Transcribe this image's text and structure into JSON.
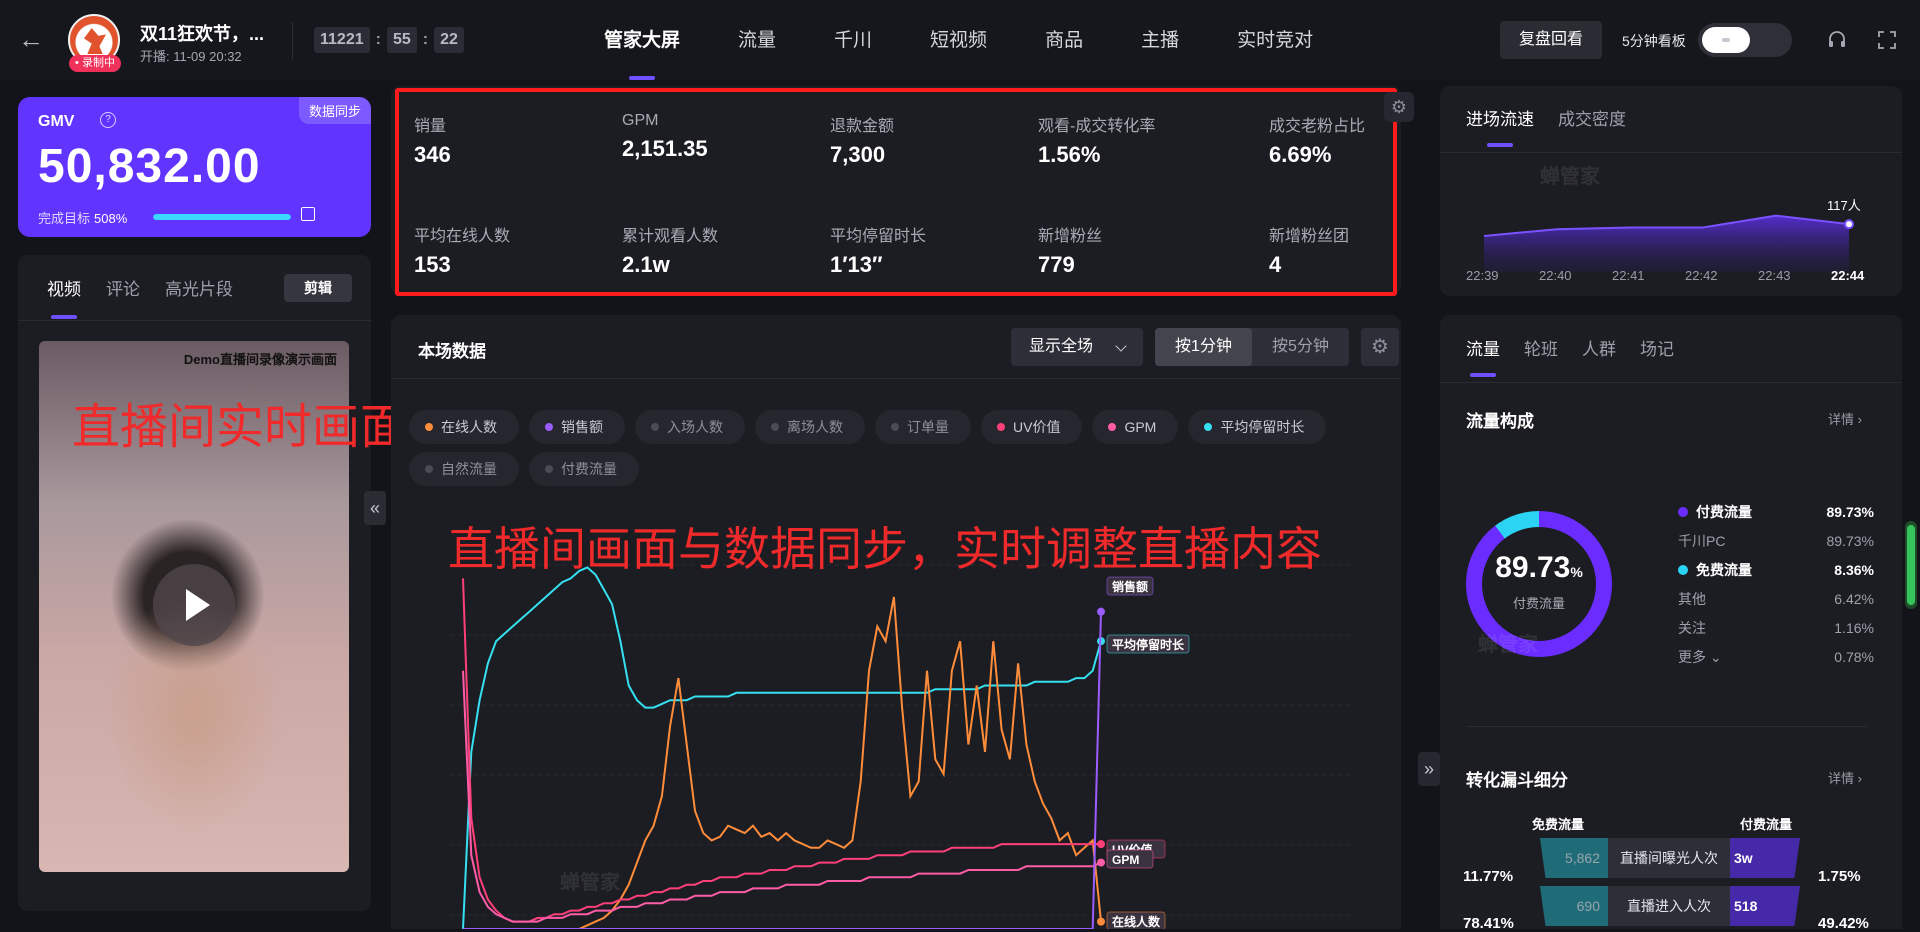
{
  "topbar": {
    "back_icon": "arrow-left-icon",
    "room_title": "双11狂欢节，...",
    "recording_badge": "• 录制中",
    "start_time": "开播:  11-09 20:32",
    "timer": {
      "hours": "11221",
      "minutes": "55",
      "seconds": "22"
    },
    "nav_tabs": [
      {
        "label": "管家大屏",
        "active": true
      },
      {
        "label": "流量"
      },
      {
        "label": "千川"
      },
      {
        "label": "短视频"
      },
      {
        "label": "商品"
      },
      {
        "label": "主播"
      },
      {
        "label": "实时竞对"
      }
    ],
    "replay_button": "复盘回看",
    "five_min_board": "5分钟看板",
    "headset_icon": "headset-icon",
    "fullscreen_icon": "fullscreen-icon"
  },
  "gmv": {
    "label": "GMV",
    "sync_badge": "数据同步",
    "value": "50,832.00",
    "target_label": "完成目标",
    "target_pct": "508%",
    "progress": 1.0
  },
  "video_panel": {
    "tabs": [
      "视频",
      "评论",
      "高光片段"
    ],
    "cut_button": "剪辑",
    "demo_caption": "Demo直播间录像演示画面",
    "overlay_text": "直播间实时画面"
  },
  "metrics": [
    {
      "label": "销量",
      "value": "346"
    },
    {
      "label": "GPM",
      "value": "2,151.35"
    },
    {
      "label": "退款金额",
      "value": "7,300"
    },
    {
      "label": "观看-成交转化率",
      "value": "1.56%"
    },
    {
      "label": "成交老粉占比",
      "value": "6.69%"
    },
    {
      "label": "平均在线人数",
      "value": "153"
    },
    {
      "label": "累计观看人数",
      "value": "2.1w"
    },
    {
      "label": "平均停留时长",
      "value": "1′13′′"
    },
    {
      "label": "新增粉丝",
      "value": "779"
    },
    {
      "label": "新增粉丝团",
      "value": "4"
    }
  ],
  "session_data": {
    "title": "本场数据",
    "scope_select": "显示全场",
    "granularity": [
      "按1分钟",
      "按5分钟"
    ],
    "legend": [
      {
        "label": "在线人数",
        "color": "#ff8c3a",
        "on": true
      },
      {
        "label": "销售额",
        "color": "#9b5cff",
        "on": true
      },
      {
        "label": "入场人数",
        "color": "#4a4b55",
        "on": false
      },
      {
        "label": "离场人数",
        "color": "#4a4b55",
        "on": false
      },
      {
        "label": "订单量",
        "color": "#4a4b55",
        "on": false
      },
      {
        "label": "UV价值",
        "color": "#ff3f7a",
        "on": true
      },
      {
        "label": "GPM",
        "color": "#ff5ca8",
        "on": true
      },
      {
        "label": "平均停留时长",
        "color": "#35e0f0",
        "on": true
      },
      {
        "label": "自然流量",
        "color": "#4a4b55",
        "on": false
      },
      {
        "label": "付费流量",
        "color": "#4a4b55",
        "on": false
      }
    ],
    "overlay_text": "直播间画面与数据同步，实时调整直播内容",
    "end_labels": [
      "销售额",
      "平均停留时长",
      "UV价值",
      "GPM",
      "在线人数"
    ]
  },
  "chart_data": {
    "type": "line",
    "title": "",
    "series": [
      {
        "name": "平均停留时长",
        "color": "#35e0f0",
        "values": [
          0,
          0.48,
          0.62,
          0.72,
          0.78,
          0.8,
          0.82,
          0.84,
          0.86,
          0.88,
          0.9,
          0.92,
          0.94,
          0.95,
          0.97,
          0.98,
          0.96,
          0.92,
          0.88,
          0.78,
          0.66,
          0.62,
          0.6,
          0.6,
          0.61,
          0.62,
          0.62,
          0.62,
          0.63,
          0.63,
          0.63,
          0.63,
          0.63,
          0.64,
          0.64,
          0.64,
          0.64,
          0.64,
          0.64,
          0.64,
          0.64,
          0.64,
          0.64,
          0.64,
          0.64,
          0.64,
          0.64,
          0.64,
          0.64,
          0.64,
          0.64,
          0.64,
          0.64,
          0.64,
          0.64,
          0.64,
          0.64,
          0.65,
          0.65,
          0.65,
          0.65,
          0.65,
          0.65,
          0.66,
          0.66,
          0.66,
          0.66,
          0.66,
          0.66,
          0.67,
          0.67,
          0.67,
          0.67,
          0.67,
          0.68,
          0.68,
          0.7,
          0.78
        ]
      },
      {
        "name": "在线人数",
        "color": "#ff8c3a",
        "values": [
          0,
          0,
          0,
          0,
          0,
          0,
          0,
          0,
          0,
          0,
          0,
          0,
          0,
          0,
          0,
          0.01,
          0.02,
          0.03,
          0.05,
          0.08,
          0.12,
          0.18,
          0.24,
          0.28,
          0.36,
          0.55,
          0.68,
          0.5,
          0.32,
          0.26,
          0.24,
          0.25,
          0.28,
          0.27,
          0.26,
          0.28,
          0.25,
          0.26,
          0.24,
          0.26,
          0.24,
          0.23,
          0.22,
          0.22,
          0.24,
          0.23,
          0.22,
          0.24,
          0.4,
          0.7,
          0.82,
          0.78,
          0.9,
          0.6,
          0.36,
          0.4,
          0.7,
          0.46,
          0.42,
          0.7,
          0.78,
          0.5,
          0.66,
          0.48,
          0.78,
          0.54,
          0.46,
          0.72,
          0.5,
          0.4,
          0.34,
          0.3,
          0.24,
          0.26,
          0.2,
          0.22,
          0.24,
          0.02
        ]
      },
      {
        "name": "UV价值",
        "color": "#ff3f7a",
        "values": [
          0.95,
          0.3,
          0.14,
          0.08,
          0.05,
          0.03,
          0.02,
          0.02,
          0.02,
          0.03,
          0.03,
          0.04,
          0.04,
          0.05,
          0.05,
          0.06,
          0.06,
          0.07,
          0.07,
          0.08,
          0.08,
          0.09,
          0.09,
          0.1,
          0.1,
          0.11,
          0.11,
          0.12,
          0.12,
          0.13,
          0.13,
          0.14,
          0.14,
          0.14,
          0.15,
          0.15,
          0.15,
          0.16,
          0.16,
          0.16,
          0.17,
          0.17,
          0.17,
          0.18,
          0.18,
          0.18,
          0.19,
          0.19,
          0.19,
          0.19,
          0.2,
          0.2,
          0.2,
          0.2,
          0.21,
          0.21,
          0.21,
          0.21,
          0.21,
          0.22,
          0.22,
          0.22,
          0.22,
          0.22,
          0.22,
          0.23,
          0.23,
          0.23,
          0.23,
          0.23,
          0.23,
          0.23,
          0.23,
          0.23,
          0.23,
          0.23,
          0.23,
          0.23
        ]
      },
      {
        "name": "GPM",
        "color": "#ff5ca8",
        "values": [
          0.7,
          0.2,
          0.1,
          0.06,
          0.04,
          0.03,
          0.02,
          0.02,
          0.02,
          0.02,
          0.03,
          0.03,
          0.03,
          0.04,
          0.04,
          0.04,
          0.05,
          0.05,
          0.05,
          0.06,
          0.06,
          0.06,
          0.07,
          0.07,
          0.07,
          0.08,
          0.08,
          0.08,
          0.09,
          0.09,
          0.09,
          0.1,
          0.1,
          0.1,
          0.1,
          0.11,
          0.11,
          0.11,
          0.11,
          0.12,
          0.12,
          0.12,
          0.12,
          0.12,
          0.13,
          0.13,
          0.13,
          0.13,
          0.13,
          0.14,
          0.14,
          0.14,
          0.14,
          0.14,
          0.14,
          0.15,
          0.15,
          0.15,
          0.15,
          0.15,
          0.15,
          0.16,
          0.16,
          0.16,
          0.16,
          0.16,
          0.16,
          0.16,
          0.17,
          0.17,
          0.17,
          0.17,
          0.17,
          0.17,
          0.17,
          0.17,
          0.17,
          0.18
        ]
      },
      {
        "name": "销售额",
        "color": "#9b5cff",
        "values": [
          0,
          0,
          0,
          0,
          0,
          0,
          0,
          0,
          0,
          0,
          0,
          0,
          0,
          0,
          0,
          0,
          0,
          0,
          0,
          0,
          0,
          0,
          0,
          0,
          0,
          0,
          0,
          0,
          0,
          0,
          0,
          0,
          0,
          0,
          0,
          0,
          0,
          0,
          0,
          0,
          0,
          0,
          0,
          0,
          0,
          0,
          0,
          0,
          0,
          0,
          0,
          0,
          0,
          0,
          0,
          0,
          0,
          0,
          0,
          0,
          0,
          0,
          0,
          0,
          0,
          0,
          0,
          0,
          0,
          0,
          0,
          0,
          0,
          0,
          0,
          0,
          0,
          0.86
        ]
      }
    ]
  },
  "entry_flow": {
    "tabs": [
      "进场流速",
      "成交密度"
    ],
    "end_value": "117人",
    "times": [
      "22:39",
      "22:40",
      "22:41",
      "22:42",
      "22:43",
      "22:44"
    ],
    "values": [
      110,
      114,
      115,
      115,
      122,
      117
    ]
  },
  "traffic": {
    "tabs": [
      "流量",
      "轮班",
      "人群",
      "场记"
    ],
    "composition_title": "流量构成",
    "detail_label": "详情 ›",
    "donut_pct": "89.73",
    "donut_pct_unit": "%",
    "donut_label": "付费流量",
    "donut_colors": {
      "paid": "#6a2cff",
      "free": "#2ad4f2"
    },
    "paid_share": 0.8973,
    "rows": [
      {
        "label": "付费流量",
        "value": "89.73%",
        "type": "main",
        "color": "#6a2cff"
      },
      {
        "label": "千川PC",
        "value": "89.73%",
        "type": "sub"
      },
      {
        "label": "免费流量",
        "value": "8.36%",
        "type": "main",
        "color": "#2ad4f2"
      },
      {
        "label": "其他",
        "value": "6.42%",
        "type": "sub"
      },
      {
        "label": "关注",
        "value": "1.16%",
        "type": "sub"
      },
      {
        "label": "更多 ⌄",
        "value": "0.78%",
        "type": "sub"
      }
    ],
    "funnel_title": "转化漏斗细分",
    "funnel_detail": "详情 ›",
    "funnel_free_head": "免费流量",
    "funnel_paid_head": "付费流量",
    "funnel_rows": [
      {
        "free": "5,862",
        "label": "直播间曝光人次",
        "paid": "3w",
        "left_pct": "11.77%",
        "right_pct": "1.75%"
      },
      {
        "free": "690",
        "label": "直播进入人次",
        "paid": "518",
        "left_pct": "78.41%",
        "right_pct": "49.42%"
      }
    ]
  },
  "watermark": "蝉管家"
}
